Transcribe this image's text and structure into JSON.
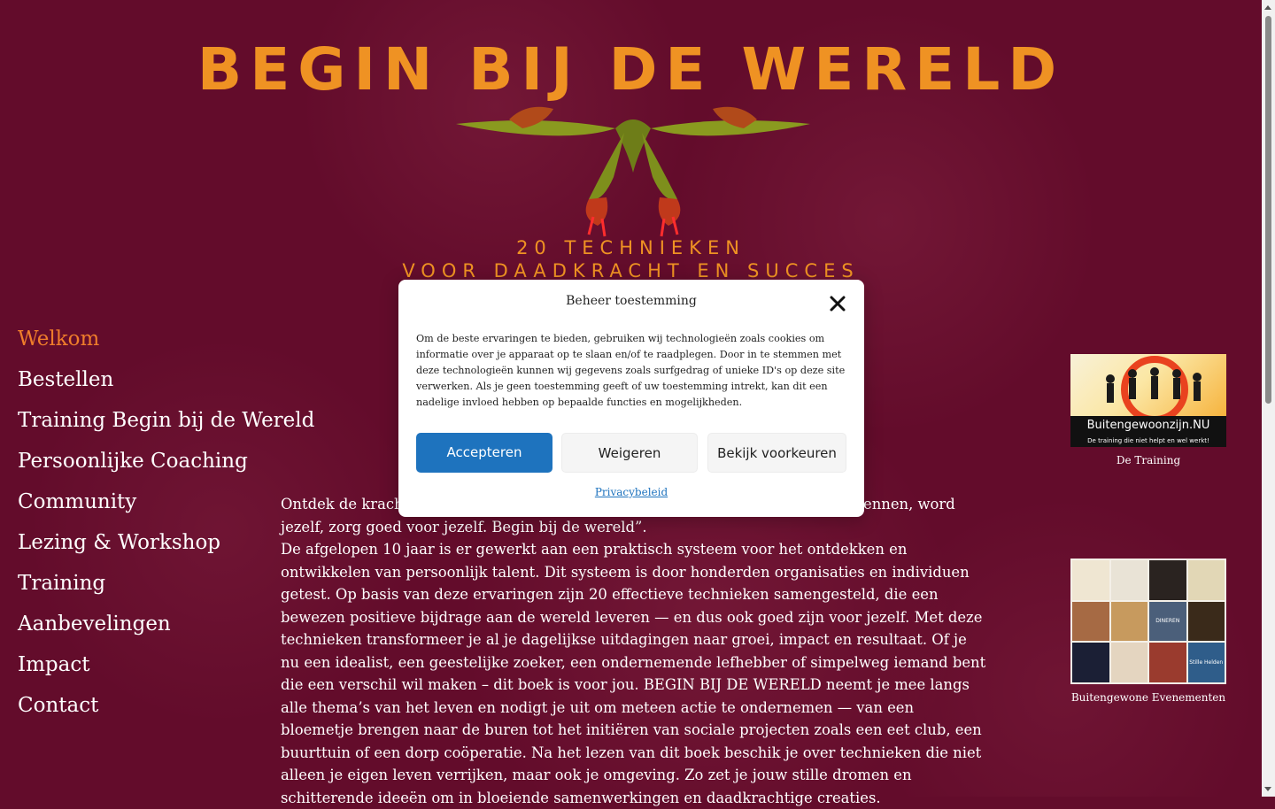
{
  "header": {
    "title": "BEGIN BIJ DE WERELD",
    "subtitle_line1": "20 TECHNIEKEN",
    "subtitle_line2": "VOOR DAADKRACHT EN SUCCES"
  },
  "nav": {
    "items": [
      {
        "label": "Welkom",
        "active": true
      },
      {
        "label": "Bestellen"
      },
      {
        "label": "Training Begin bij de Wereld"
      },
      {
        "label": "Persoonlijke Coaching"
      },
      {
        "label": "Community"
      },
      {
        "label": "Lezing & Workshop"
      },
      {
        "label": "Training"
      },
      {
        "label": "Aanbevelingen"
      },
      {
        "label": "Impact"
      },
      {
        "label": "Contact"
      }
    ]
  },
  "content": {
    "paragraph1": "Ontdek de kracht van samenwerken en de vreugde van bijdragen. Leer jezelf kennen, word jezelf, zorg goed voor jezelf. Begin bij de wereld”.",
    "paragraph2": "De afgelopen 10 jaar is er gewerkt aan een praktisch systeem voor het ontdekken en ontwikkelen van persoonlijk talent. Dit systeem is door honderden organisaties en individuen getest. Op basis van deze ervaringen zijn 20 effectieve technieken samengesteld, die een bewezen positieve bijdrage aan de wereld leveren — en dus ook goed zijn voor jezelf. Met deze technieken transformeer je al je dagelijkse uitdagingen naar groei, impact en resultaat. Of je nu een idealist, een geestelijke zoeker, een ondernemende lefhebber of simpelweg iemand bent die een verschil wil maken – dit boek is voor jou. BEGIN BIJ DE WERELD neemt je mee langs alle thema’s van het leven en nodigt je uit om meteen actie te ondernemen — van een bloemetje brengen naar de buren tot het initiëren van sociale projecten zoals een eet club, een buurttuin of een dorp coöperatie. Na het lezen van dit boek beschik je over technieken die niet alleen je eigen leven verrijken, maar ook je omgeving. Zo zet je jouw stille dromen en schitterende ideeën om in bloeiende samenwerkingen en daadkrachtige creaties."
  },
  "sidebar": {
    "training": {
      "brand": "Buitengewoonzijn.NU",
      "tagline": "De training die niet helpt en wel werkt!",
      "caption": "De Training"
    },
    "events": {
      "caption": "Buitengewone Evenementen",
      "tiles": [
        "",
        "",
        "",
        "",
        "",
        "",
        "DINEREN",
        "",
        "",
        "",
        "",
        "Stille Helden"
      ]
    }
  },
  "consent_modal": {
    "title": "Beheer toestemming",
    "body": "Om de beste ervaringen te bieden, gebruiken wij technologieën zoals cookies om informatie over je apparaat op te slaan en/of te raadplegen. Door in te stemmen met deze technologieën kunnen wij gegevens zoals surfgedrag of unieke ID's op deze site verwerken. Als je geen toestemming geeft of uw toestemming intrekt, kan dit een nadelige invloed hebben op bepaalde functies en mogelijkheden.",
    "accept_label": "Accepteren",
    "deny_label": "Weigeren",
    "preferences_label": "Bekijk voorkeuren",
    "privacy_link": "Privacybeleid"
  },
  "colors": {
    "background": "#630c2b",
    "accent_orange": "#ef9223",
    "button_blue": "#1e73be"
  }
}
